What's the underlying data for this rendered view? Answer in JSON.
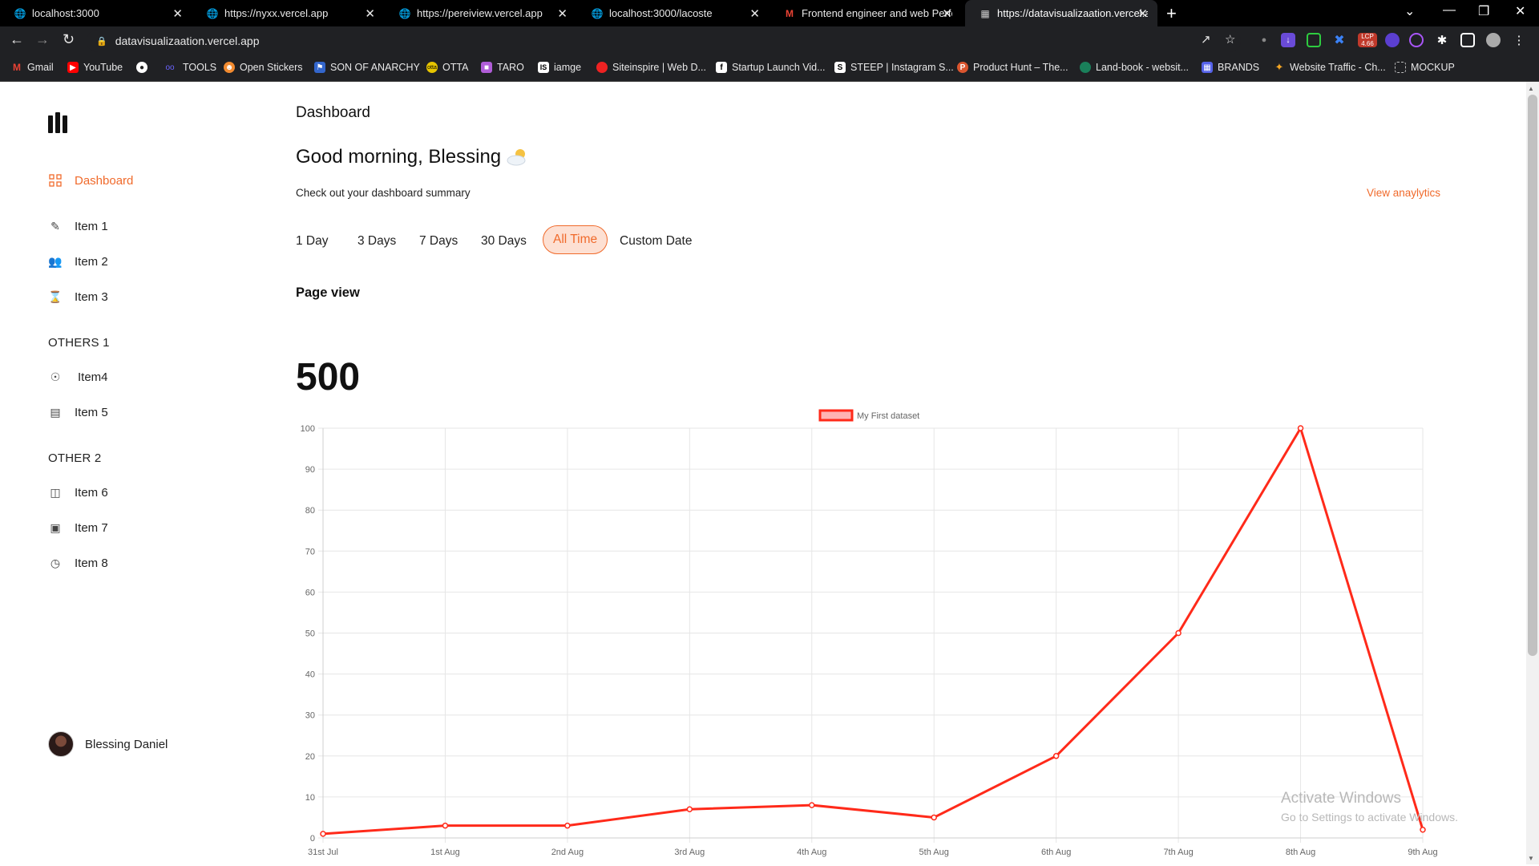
{
  "browser": {
    "tabs": [
      {
        "title": "localhost:3000",
        "icon": "globe-icon",
        "active": false
      },
      {
        "title": "https://nyxx.vercel.app",
        "icon": "globe-icon",
        "active": false
      },
      {
        "title": "https://pereiview.vercel.app",
        "icon": "globe-icon",
        "active": false
      },
      {
        "title": "localhost:3000/lacoste",
        "icon": "globe-icon",
        "active": false
      },
      {
        "title": "Frontend engineer and web Perfo",
        "icon": "gmail-icon",
        "active": false
      },
      {
        "title": "https://datavisualizaation.vercel.a",
        "icon": "app-icon",
        "active": true
      }
    ],
    "url": "datavisualizaation.vercel.app",
    "ext_badge": "4.66",
    "bookmarks": [
      {
        "label": "Gmail",
        "icon": "gmail-icon",
        "color": "#ea4335"
      },
      {
        "label": "YouTube",
        "icon": "youtube-icon",
        "color": "#ff0000"
      },
      {
        "label": "",
        "icon": "globe-icon",
        "color": "#5f6368"
      },
      {
        "label": "TOOLS",
        "icon": "tools-icon",
        "color": "#6b63ff"
      },
      {
        "label": "Open Stickers",
        "icon": "sticker-icon",
        "color": "#f28b30"
      },
      {
        "label": "SON OF ANARCHY",
        "icon": "flag-icon",
        "color": "#3366cc"
      },
      {
        "label": "OTTA",
        "icon": "otta-icon",
        "color": "#e7c500"
      },
      {
        "label": "TARO",
        "icon": "taro-icon",
        "color": "#b05dd8"
      },
      {
        "label": "iamge",
        "icon": "is-icon",
        "color": "#222222"
      },
      {
        "label": "Siteinspire | Web D...",
        "icon": "siteinspire-icon",
        "color": "#e22"
      },
      {
        "label": "Startup Launch Vid...",
        "icon": "facebook-icon",
        "color": "#fff"
      },
      {
        "label": "STEEP | Instagram S...",
        "icon": "steep-icon",
        "color": "#111"
      },
      {
        "label": "Product Hunt – The...",
        "icon": "producthunt-icon",
        "color": "#da552f"
      },
      {
        "label": "Land-book - websit...",
        "icon": "landbook-icon",
        "color": "#1a7f5a"
      },
      {
        "label": "BRANDS",
        "icon": "brands-icon",
        "color": "#5562e8"
      },
      {
        "label": "Website Traffic - Ch...",
        "icon": "traffic-icon",
        "color": "#f5a623"
      },
      {
        "label": "MOCKUP",
        "icon": "mockup-icon",
        "color": "#666"
      }
    ]
  },
  "sidebar": {
    "items": [
      {
        "label": "Dashboard",
        "icon": "grid-icon",
        "active": true
      },
      {
        "label": "Item 1",
        "icon": "pencil-icon"
      },
      {
        "label": "Item 2",
        "icon": "users-icon"
      },
      {
        "label": "Item 3",
        "icon": "hourglass-icon"
      }
    ],
    "section1": "OTHERS 1",
    "items_section1": [
      {
        "label": "Item4",
        "icon": "camera-icon"
      },
      {
        "label": "Item 5",
        "icon": "calendar-icon"
      }
    ],
    "section2": "OTHER 2",
    "items_section2": [
      {
        "label": "Item 6",
        "icon": "media-icon"
      },
      {
        "label": "Item 7",
        "icon": "document-icon"
      },
      {
        "label": "Item 8",
        "icon": "clock-icon"
      }
    ],
    "user_name": "Blessing Daniel"
  },
  "main": {
    "page_title": "Dashboard",
    "greeting": "Good morning, Blessing",
    "greeting_icon": "sun-cloud-icon",
    "subtitle": "Check out your dashboard summary",
    "view_link": "View anaylytics",
    "ranges": [
      "1 Day",
      "3 Days",
      "7 Days",
      "30 Days",
      "All Time",
      "Custom Date"
    ],
    "active_range": "All Time",
    "section_label": "Page view",
    "total": "500"
  },
  "colors": {
    "accent": "#f06a2b",
    "accent_bg": "#fde0d3",
    "line": "#ff2a1a",
    "legend_fill": "#ffb3b3"
  },
  "chart_data": {
    "type": "line",
    "categories": [
      "31st Jul",
      "1st Aug",
      "2nd Aug",
      "3rd Aug",
      "4th Aug",
      "5th Aug",
      "6th Aug",
      "7th Aug",
      "8th Aug",
      "9th Aug"
    ],
    "series": [
      {
        "name": "My First dataset",
        "values": [
          1,
          3,
          3,
          7,
          8,
          5,
          20,
          50,
          100,
          2
        ]
      }
    ],
    "ylim": [
      0,
      100
    ],
    "yticks": [
      0,
      10,
      20,
      30,
      40,
      50,
      60,
      70,
      80,
      90,
      100
    ],
    "grid": true,
    "legend": "top-center"
  },
  "watermark": {
    "line1": "Activate Windows",
    "line2": "Go to Settings to activate Windows."
  }
}
